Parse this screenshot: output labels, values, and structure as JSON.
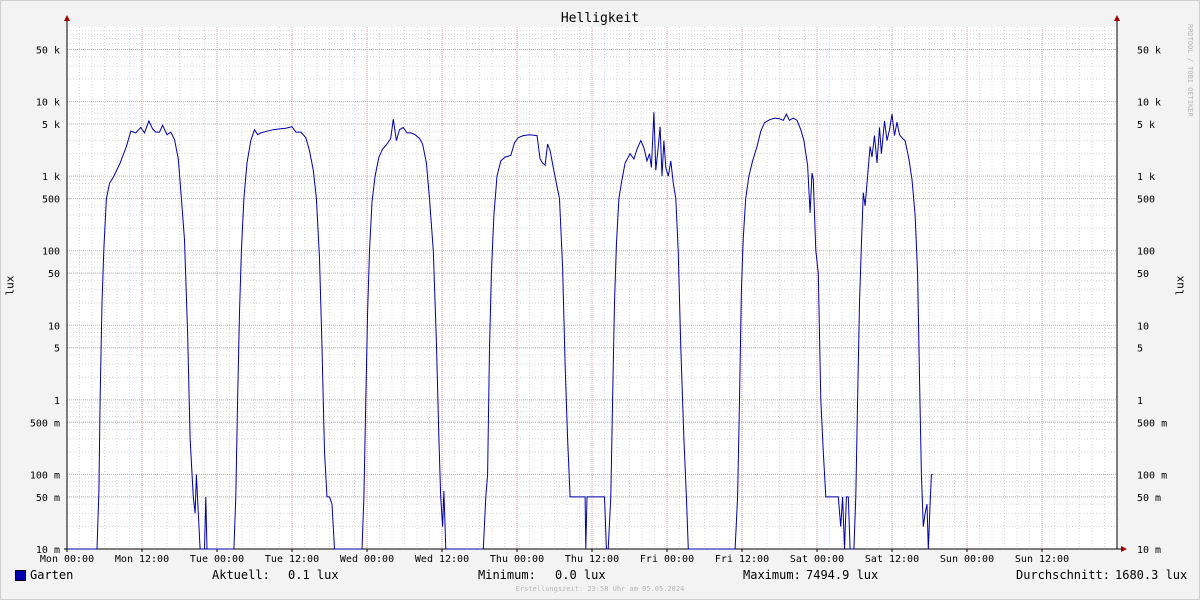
{
  "title": "Helligkeit",
  "watermark": "RRDTOOL / TOBI OETIKER",
  "footer": "Erstellungszeit: 23:58 Uhr am 05.05.2024",
  "legend": {
    "series_name": "Garten",
    "current_label": "Aktuell:",
    "current_value": "0.1 lux",
    "min_label": "Minimum:",
    "min_value": "0.0 lux",
    "max_label": "Maximum:",
    "max_value": "7494.9 lux",
    "avg_label": "Durchschnitt:",
    "avg_value": "1680.3 lux"
  },
  "colors": {
    "series": "#0000aa",
    "major_grid": "#e8a0a0",
    "minor_grid": "#d8d8d8",
    "plot_bg": "#ffffff",
    "arrow": "#a00000"
  },
  "chart_data": {
    "type": "line",
    "title": "Helligkeit",
    "ylabel": "lux",
    "y_scale": "log",
    "ylim": [
      0.01,
      100000
    ],
    "xlim": [
      0,
      168
    ],
    "x_unit": "hours since Mon 00:00",
    "x_ticks": [
      {
        "x": 0,
        "label": "Mon 00:00"
      },
      {
        "x": 12,
        "label": "Mon 12:00"
      },
      {
        "x": 24,
        "label": "Tue 00:00"
      },
      {
        "x": 36,
        "label": "Tue 12:00"
      },
      {
        "x": 48,
        "label": "Wed 00:00"
      },
      {
        "x": 60,
        "label": "Wed 12:00"
      },
      {
        "x": 72,
        "label": "Thu 00:00"
      },
      {
        "x": 84,
        "label": "Thu 12:00"
      },
      {
        "x": 96,
        "label": "Fri 00:00"
      },
      {
        "x": 108,
        "label": "Fri 12:00"
      },
      {
        "x": 120,
        "label": "Sat 00:00"
      },
      {
        "x": 132,
        "label": "Sat 12:00"
      },
      {
        "x": 144,
        "label": "Sun 00:00"
      },
      {
        "x": 156,
        "label": "Sun 12:00"
      }
    ],
    "y_ticks": [
      {
        "v": 50000,
        "label": "50 k"
      },
      {
        "v": 10000,
        "label": "10 k"
      },
      {
        "v": 5000,
        "label": "5 k"
      },
      {
        "v": 1000,
        "label": "1 k"
      },
      {
        "v": 500,
        "label": "500"
      },
      {
        "v": 100,
        "label": "100"
      },
      {
        "v": 50,
        "label": "50"
      },
      {
        "v": 10,
        "label": "10"
      },
      {
        "v": 5,
        "label": "5"
      },
      {
        "v": 1,
        "label": "1"
      },
      {
        "v": 0.5,
        "label": "500 m"
      },
      {
        "v": 0.1,
        "label": "100 m"
      },
      {
        "v": 0.05,
        "label": "50 m"
      },
      {
        "v": 0.01,
        "label": "10 m"
      }
    ],
    "series": [
      {
        "name": "Garten",
        "points": [
          [
            0,
            0.01
          ],
          [
            4.8,
            0.01
          ],
          [
            5.1,
            0.06
          ],
          [
            5.3,
            1
          ],
          [
            5.6,
            20
          ],
          [
            5.9,
            110
          ],
          [
            6.3,
            500
          ],
          [
            6.8,
            800
          ],
          [
            7.5,
            1000
          ],
          [
            8.5,
            1500
          ],
          [
            9.5,
            2500
          ],
          [
            10.2,
            4000
          ],
          [
            11,
            3800
          ],
          [
            11.8,
            4500
          ],
          [
            12.4,
            3800
          ],
          [
            13.1,
            5500
          ],
          [
            13.7,
            4300
          ],
          [
            14.2,
            3900
          ],
          [
            14.8,
            3900
          ],
          [
            15.3,
            4800
          ],
          [
            16,
            3600
          ],
          [
            16.6,
            3900
          ],
          [
            17.2,
            3100
          ],
          [
            17.8,
            1700
          ],
          [
            18.3,
            500
          ],
          [
            18.8,
            140
          ],
          [
            19.3,
            8
          ],
          [
            19.7,
            0.3
          ],
          [
            20.2,
            0.05
          ],
          [
            20.5,
            0.03
          ],
          [
            20.7,
            0.1
          ],
          [
            21,
            0.03
          ],
          [
            21.3,
            0.01
          ],
          [
            22,
            0.01
          ],
          [
            22.2,
            0.05
          ],
          [
            22.4,
            0.01
          ],
          [
            26.7,
            0.01
          ],
          [
            27,
            0.05
          ],
          [
            27.3,
            1
          ],
          [
            27.6,
            15
          ],
          [
            27.9,
            100
          ],
          [
            28.3,
            500
          ],
          [
            28.8,
            1500
          ],
          [
            29.4,
            3000
          ],
          [
            30,
            4200
          ],
          [
            30.5,
            3600
          ],
          [
            31,
            3800
          ],
          [
            32,
            4000
          ],
          [
            33,
            4200
          ],
          [
            34,
            4300
          ],
          [
            35,
            4400
          ],
          [
            36,
            4600
          ],
          [
            36.6,
            3900
          ],
          [
            37.4,
            3900
          ],
          [
            38.2,
            3300
          ],
          [
            38.8,
            2200
          ],
          [
            39.4,
            1200
          ],
          [
            39.9,
            500
          ],
          [
            40.4,
            80
          ],
          [
            40.8,
            5
          ],
          [
            41.2,
            0.2
          ],
          [
            41.6,
            0.05
          ],
          [
            42,
            0.05
          ],
          [
            42.4,
            0.04
          ],
          [
            42.8,
            0.01
          ],
          [
            47.2,
            0.01
          ],
          [
            47.5,
            0.05
          ],
          [
            47.8,
            1
          ],
          [
            48.1,
            15
          ],
          [
            48.4,
            100
          ],
          [
            48.8,
            450
          ],
          [
            49.3,
            1000
          ],
          [
            49.9,
            1800
          ],
          [
            50.5,
            2300
          ],
          [
            51.2,
            2700
          ],
          [
            51.8,
            3200
          ],
          [
            52.2,
            5800
          ],
          [
            52.7,
            3000
          ],
          [
            53.2,
            4200
          ],
          [
            53.8,
            4500
          ],
          [
            54.4,
            3800
          ],
          [
            55,
            3800
          ],
          [
            55.7,
            3600
          ],
          [
            56.4,
            3200
          ],
          [
            56.9,
            2700
          ],
          [
            57.5,
            1500
          ],
          [
            58,
            500
          ],
          [
            58.6,
            100
          ],
          [
            59.1,
            6
          ],
          [
            59.5,
            0.3
          ],
          [
            59.8,
            0.05
          ],
          [
            60.1,
            0.02
          ],
          [
            60.3,
            0.06
          ],
          [
            60.6,
            0.01
          ],
          [
            66.6,
            0.01
          ],
          [
            67,
            0.05
          ],
          [
            67.3,
            0.1
          ],
          [
            67.6,
            5
          ],
          [
            67.9,
            50
          ],
          [
            68.3,
            300
          ],
          [
            68.8,
            1000
          ],
          [
            69.4,
            1600
          ],
          [
            70.1,
            1800
          ],
          [
            71,
            1900
          ],
          [
            71.6,
            2800
          ],
          [
            72.2,
            3300
          ],
          [
            73,
            3500
          ],
          [
            74,
            3600
          ],
          [
            75.2,
            3500
          ],
          [
            75.7,
            1700
          ],
          [
            76.1,
            1500
          ],
          [
            76.5,
            1400
          ],
          [
            76.9,
            2700
          ],
          [
            77.3,
            2200
          ],
          [
            77.8,
            1300
          ],
          [
            78.3,
            800
          ],
          [
            78.8,
            500
          ],
          [
            79.3,
            60
          ],
          [
            79.7,
            3
          ],
          [
            80.1,
            0.3
          ],
          [
            80.5,
            0.05
          ],
          [
            81,
            0.05
          ],
          [
            82,
            0.05
          ],
          [
            82.9,
            0.05
          ],
          [
            83,
            0.01
          ],
          [
            83.2,
            0.05
          ],
          [
            84.5,
            0.05
          ],
          [
            86,
            0.05
          ],
          [
            86.3,
            0.01
          ],
          [
            86.6,
            0.01
          ],
          [
            87,
            0.05
          ],
          [
            87.3,
            1
          ],
          [
            87.6,
            20
          ],
          [
            87.9,
            120
          ],
          [
            88.3,
            500
          ],
          [
            88.8,
            900
          ],
          [
            89.3,
            1500
          ],
          [
            90.1,
            2000
          ],
          [
            90.7,
            1700
          ],
          [
            91.2,
            2300
          ],
          [
            91.8,
            3000
          ],
          [
            92.3,
            2400
          ],
          [
            92.8,
            1600
          ],
          [
            93.2,
            2000
          ],
          [
            93.5,
            1300
          ],
          [
            93.9,
            7200
          ],
          [
            94.2,
            1200
          ],
          [
            94.6,
            2500
          ],
          [
            94.9,
            4600
          ],
          [
            95.2,
            1000
          ],
          [
            95.5,
            3000
          ],
          [
            95.8,
            1300
          ],
          [
            96.2,
            1000
          ],
          [
            96.6,
            1600
          ],
          [
            97,
            800
          ],
          [
            97.4,
            500
          ],
          [
            97.8,
            100
          ],
          [
            98.2,
            5
          ],
          [
            98.7,
            0.3
          ],
          [
            99.1,
            0.05
          ],
          [
            99.4,
            0.01
          ],
          [
            106.9,
            0.01
          ],
          [
            107.3,
            0.05
          ],
          [
            107.6,
            1
          ],
          [
            107.9,
            30
          ],
          [
            108.2,
            150
          ],
          [
            108.6,
            500
          ],
          [
            109.1,
            1000
          ],
          [
            109.7,
            1600
          ],
          [
            110.4,
            2500
          ],
          [
            111,
            4000
          ],
          [
            111.6,
            5200
          ],
          [
            112.4,
            5700
          ],
          [
            113.2,
            6000
          ],
          [
            114,
            5900
          ],
          [
            114.6,
            5600
          ],
          [
            115.1,
            6800
          ],
          [
            115.6,
            5600
          ],
          [
            116.2,
            6000
          ],
          [
            116.8,
            5600
          ],
          [
            117.4,
            4200
          ],
          [
            117.9,
            3000
          ],
          [
            118.5,
            1400
          ],
          [
            118.9,
            320
          ],
          [
            119.2,
            1100
          ],
          [
            119.4,
            900
          ],
          [
            119.8,
            100
          ],
          [
            120.2,
            50
          ],
          [
            120.6,
            1
          ],
          [
            121,
            0.2
          ],
          [
            121.4,
            0.05
          ],
          [
            122.5,
            0.05
          ],
          [
            123.4,
            0.05
          ],
          [
            123.8,
            0.02
          ],
          [
            124.1,
            0.05
          ],
          [
            124.4,
            0.01
          ],
          [
            124.7,
            0.05
          ],
          [
            125,
            0.05
          ],
          [
            125.3,
            0.01
          ],
          [
            125.9,
            0.01
          ],
          [
            126.2,
            0.05
          ],
          [
            126.5,
            1
          ],
          [
            126.8,
            20
          ],
          [
            127.1,
            120
          ],
          [
            127.4,
            600
          ],
          [
            127.7,
            400
          ],
          [
            128.1,
            1000
          ],
          [
            128.5,
            2500
          ],
          [
            128.8,
            1800
          ],
          [
            129.2,
            3500
          ],
          [
            129.6,
            1500
          ],
          [
            130,
            4500
          ],
          [
            130.3,
            2000
          ],
          [
            130.8,
            5500
          ],
          [
            131.2,
            3000
          ],
          [
            131.6,
            4200
          ],
          [
            132,
            6800
          ],
          [
            132.4,
            3500
          ],
          [
            132.8,
            5300
          ],
          [
            133.2,
            3600
          ],
          [
            133.7,
            3200
          ],
          [
            134.1,
            3000
          ],
          [
            134.7,
            1700
          ],
          [
            135.2,
            900
          ],
          [
            135.7,
            300
          ],
          [
            136.1,
            50
          ],
          [
            136.4,
            2
          ],
          [
            136.7,
            0.1
          ],
          [
            137,
            0.02
          ],
          [
            137.3,
            0.03
          ],
          [
            137.6,
            0.04
          ],
          [
            137.8,
            0.01
          ],
          [
            138.1,
            0.04
          ],
          [
            138.3,
            0.1
          ],
          [
            138.5,
            0.1
          ]
        ]
      }
    ]
  }
}
